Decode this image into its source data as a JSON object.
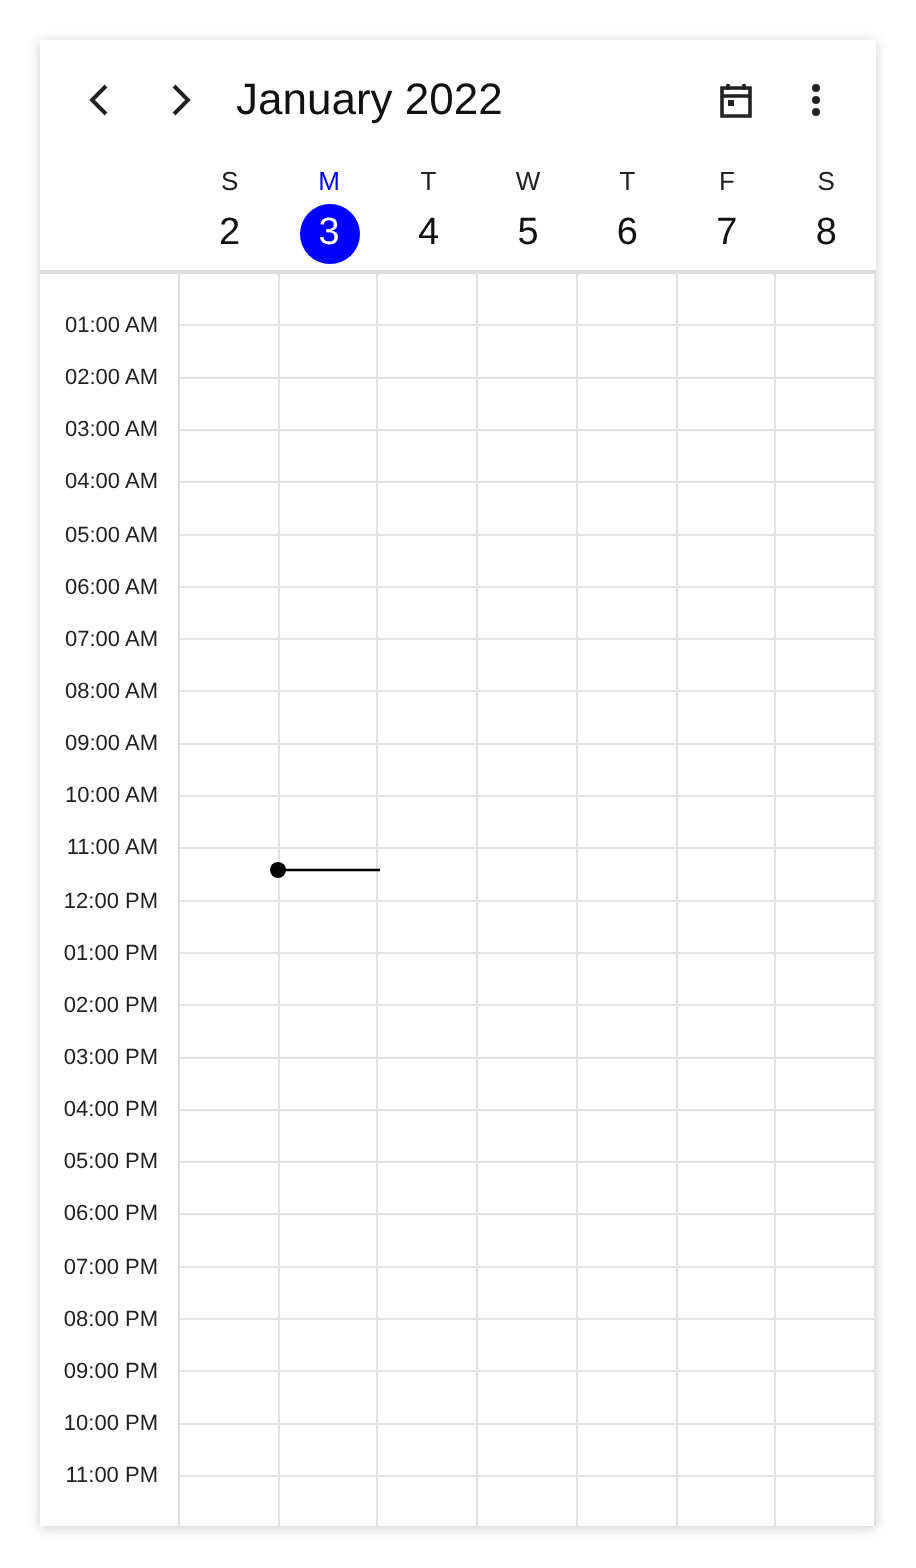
{
  "header": {
    "title": "January 2022"
  },
  "days": [
    {
      "letter": "S",
      "date": "2",
      "selected": false
    },
    {
      "letter": "M",
      "date": "3",
      "selected": true
    },
    {
      "letter": "T",
      "date": "4",
      "selected": false
    },
    {
      "letter": "W",
      "date": "5",
      "selected": false
    },
    {
      "letter": "T",
      "date": "6",
      "selected": false
    },
    {
      "letter": "F",
      "date": "7",
      "selected": false
    },
    {
      "letter": "S",
      "date": "8",
      "selected": false
    }
  ],
  "time_labels": [
    "01:00 AM",
    "02:00 AM",
    "03:00 AM",
    "04:00 AM",
    "05:00 AM",
    "06:00 AM",
    "07:00 AM",
    "08:00 AM",
    "09:00 AM",
    "10:00 AM",
    "11:00 AM",
    "12:00 PM",
    "01:00 PM",
    "02:00 PM",
    "03:00 PM",
    "04:00 PM",
    "05:00 PM",
    "06:00 PM",
    "07:00 PM",
    "08:00 PM",
    "09:00 PM",
    "10:00 PM",
    "11:00 PM"
  ],
  "current_time": {
    "level": 0.476
  }
}
